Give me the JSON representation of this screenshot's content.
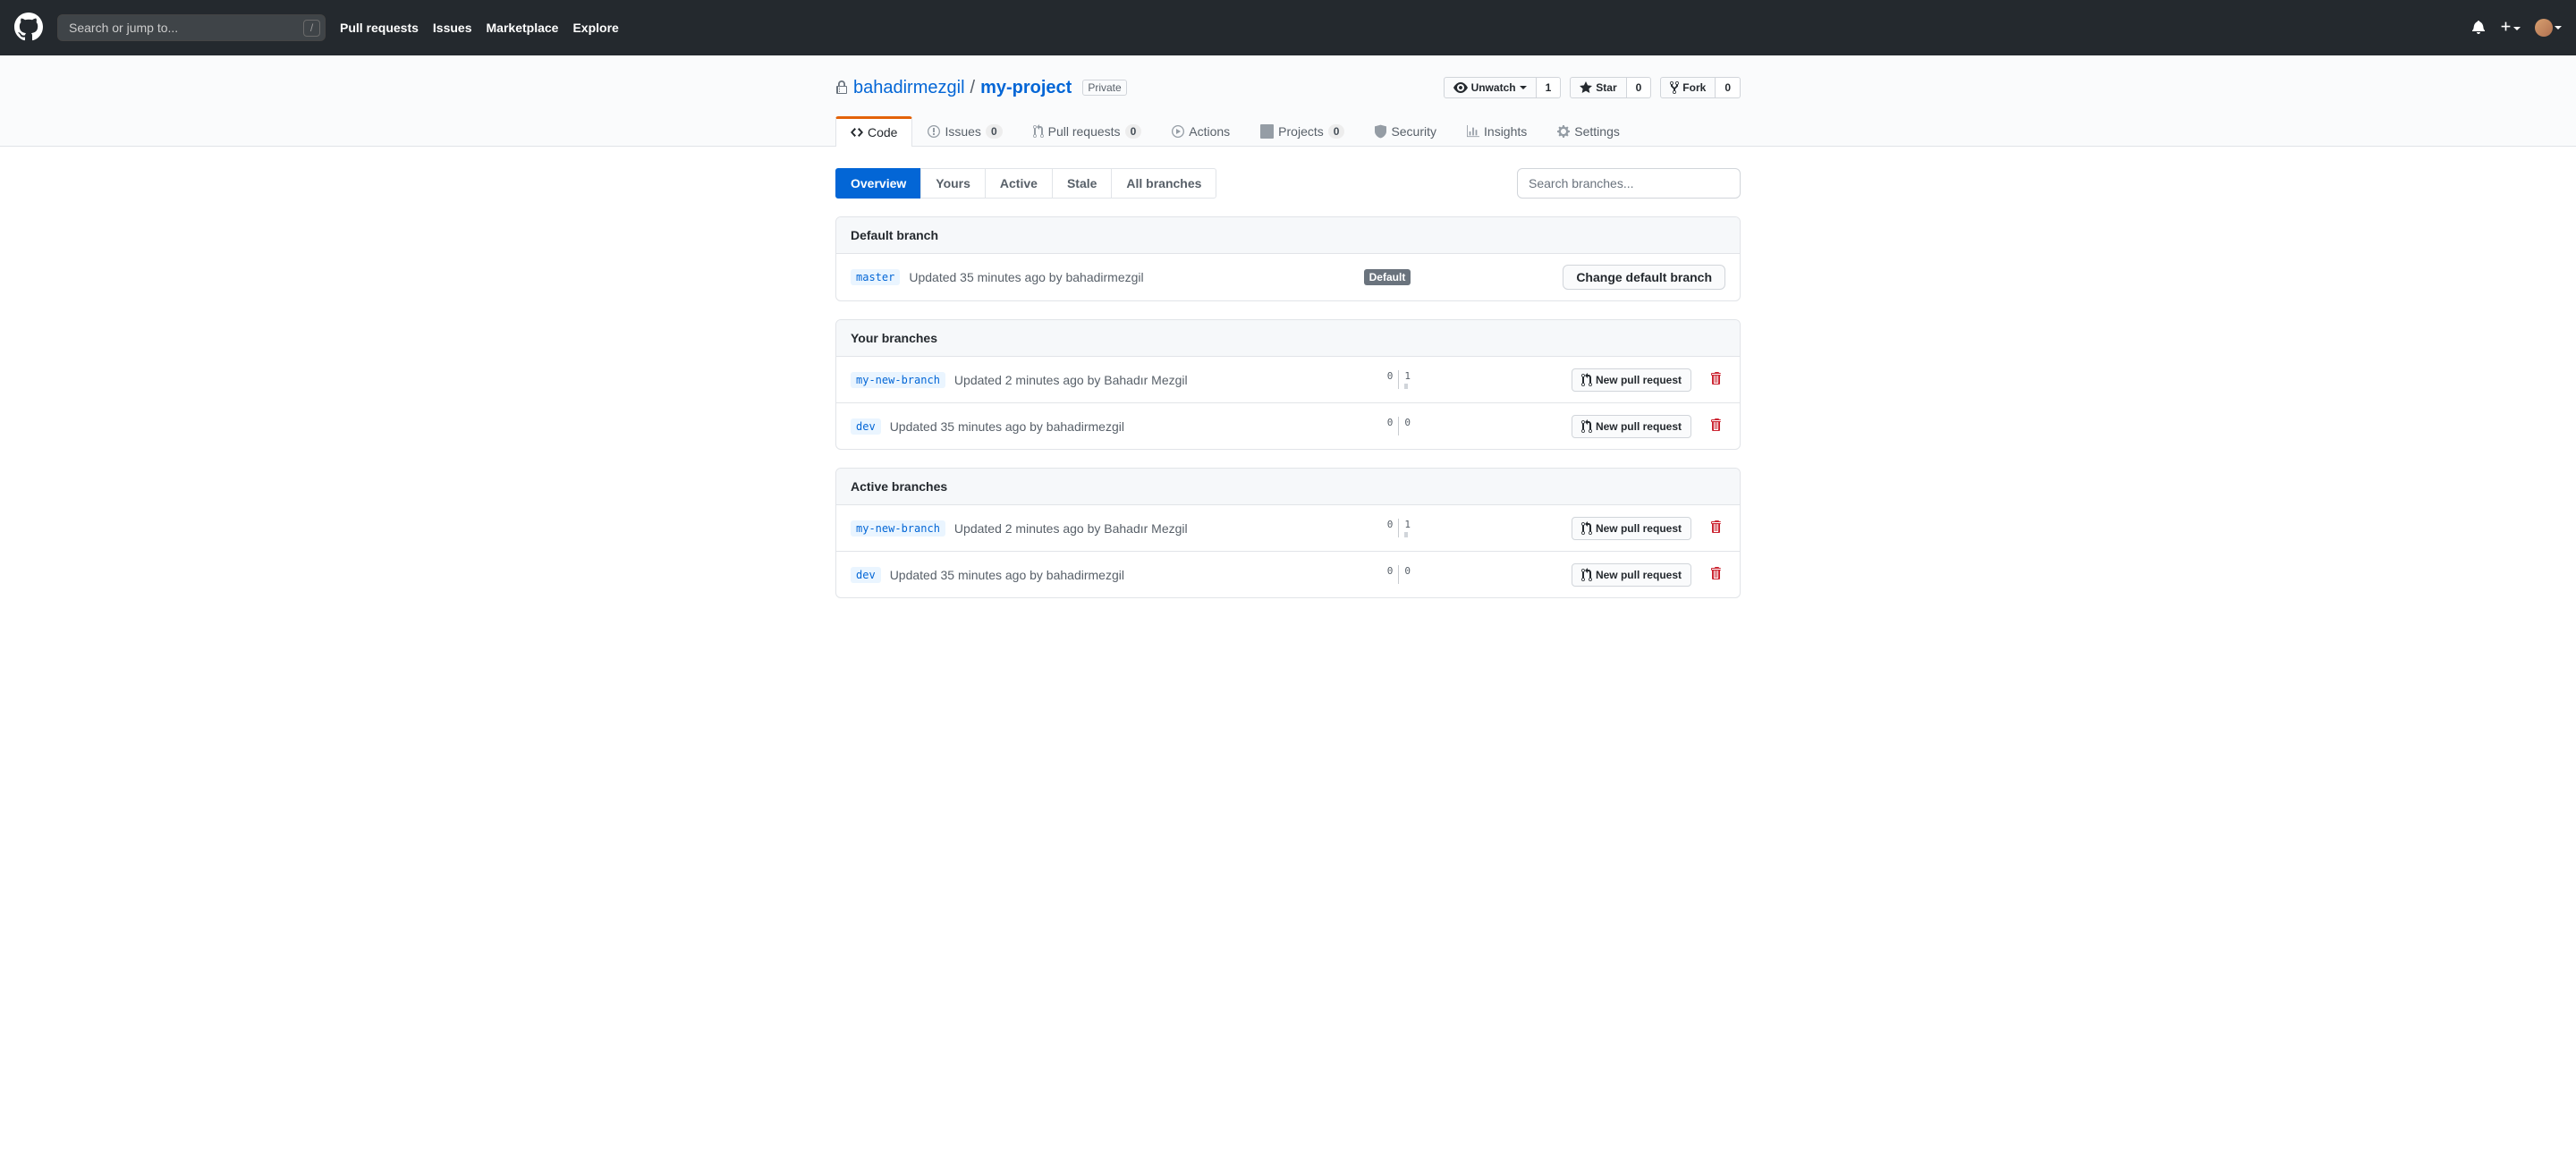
{
  "header": {
    "search_placeholder": "Search or jump to...",
    "nav": [
      "Pull requests",
      "Issues",
      "Marketplace",
      "Explore"
    ]
  },
  "repo": {
    "owner": "bahadirmezgil",
    "name": "my-project",
    "visibility": "Private",
    "watch_label": "Unwatch",
    "watch_count": "1",
    "star_label": "Star",
    "star_count": "0",
    "fork_label": "Fork",
    "fork_count": "0"
  },
  "tabs": {
    "code": "Code",
    "issues": "Issues",
    "issues_count": "0",
    "prs": "Pull requests",
    "prs_count": "0",
    "actions": "Actions",
    "projects": "Projects",
    "projects_count": "0",
    "security": "Security",
    "insights": "Insights",
    "settings": "Settings"
  },
  "subnav": {
    "overview": "Overview",
    "yours": "Yours",
    "active": "Active",
    "stale": "Stale",
    "all": "All branches",
    "search_placeholder": "Search branches..."
  },
  "sections": {
    "default_header": "Default branch",
    "your_header": "Your branches",
    "active_header": "Active branches",
    "default_label": "Default",
    "change_default_btn": "Change default branch",
    "new_pr_btn": "New pull request"
  },
  "branches": {
    "master": {
      "name": "master",
      "meta": "Updated 35 minutes ago by bahadirmezgil"
    },
    "your": [
      {
        "name": "my-new-branch",
        "meta": "Updated 2 minutes ago by Bahadır Mezgil",
        "behind": "0",
        "ahead": "1"
      },
      {
        "name": "dev",
        "meta": "Updated 35 minutes ago by bahadirmezgil",
        "behind": "0",
        "ahead": "0"
      }
    ],
    "active": [
      {
        "name": "my-new-branch",
        "meta": "Updated 2 minutes ago by Bahadır Mezgil",
        "behind": "0",
        "ahead": "1"
      },
      {
        "name": "dev",
        "meta": "Updated 35 minutes ago by bahadirmezgil",
        "behind": "0",
        "ahead": "0"
      }
    ]
  }
}
